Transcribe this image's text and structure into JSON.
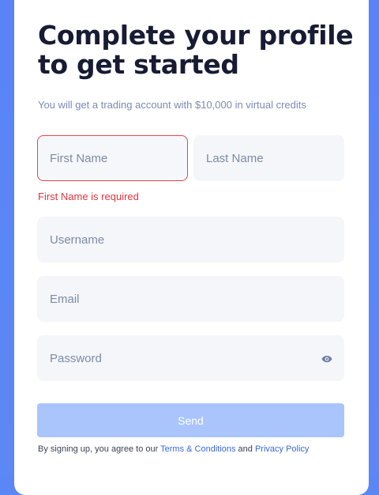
{
  "form": {
    "title": "Complete your profile to get started",
    "subtitle": "You will get a trading account with $10,000 in virtual credits",
    "first_name": {
      "placeholder": "First Name",
      "value": "",
      "error": "First Name is required"
    },
    "last_name": {
      "placeholder": "Last Name",
      "value": ""
    },
    "username": {
      "placeholder": "Username",
      "value": ""
    },
    "email": {
      "placeholder": "Email",
      "value": ""
    },
    "password": {
      "placeholder": "Password",
      "value": "",
      "icon": "eye-icon"
    },
    "submit_label": "Send",
    "terms": {
      "prefix": "By signing up, you agree to our ",
      "terms_link": "Terms & Conditions",
      "middle": " and ",
      "privacy_link": "Privacy Policy"
    }
  },
  "colors": {
    "background": "#5b86f5",
    "accent": "#3a68dd",
    "error": "#e0363f",
    "button_disabled": "#a9c5fb",
    "title": "#171b33"
  }
}
